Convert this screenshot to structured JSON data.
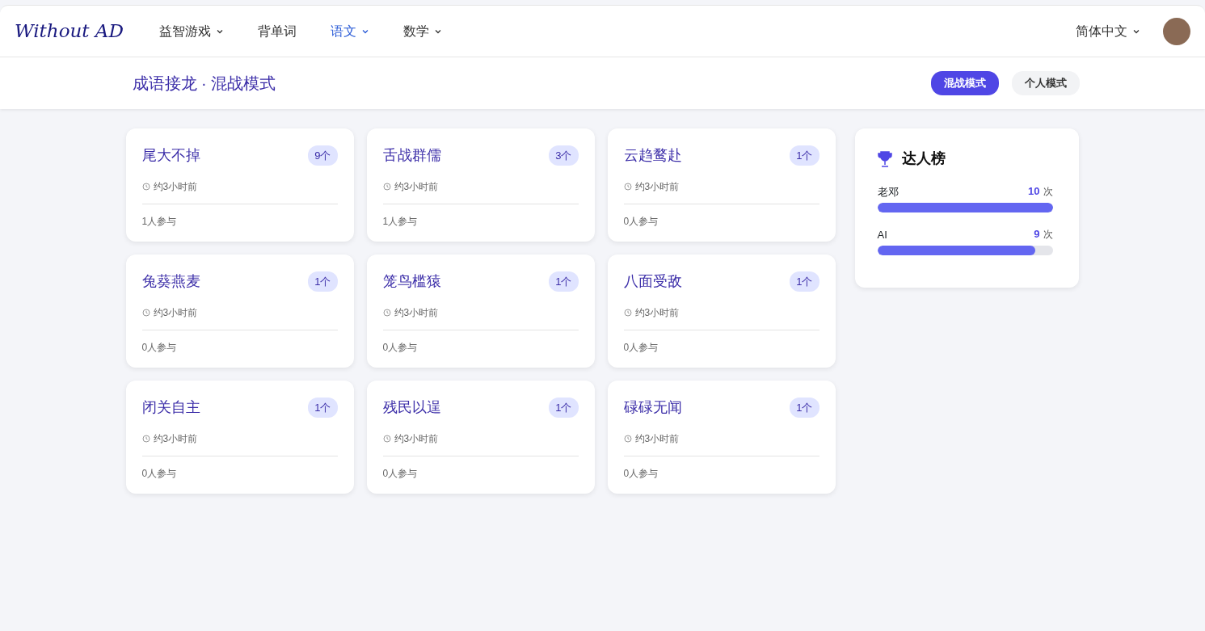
{
  "navbar": {
    "logo": "Without AD",
    "menu": [
      {
        "label": "益智游戏",
        "dropdown": true,
        "selected": false
      },
      {
        "label": "背单词",
        "dropdown": false,
        "selected": false
      },
      {
        "label": "语文",
        "dropdown": true,
        "selected": true
      },
      {
        "label": "数学",
        "dropdown": true,
        "selected": false
      }
    ],
    "language": "简体中文"
  },
  "header": {
    "title": "成语接龙 · 混战模式",
    "modes": [
      {
        "label": "混战模式",
        "selected": true
      },
      {
        "label": "个人模式",
        "selected": false
      }
    ]
  },
  "games": [
    {
      "idiom": "尾大不掉",
      "count": "9个",
      "time": "约3小时前",
      "participants": "1人参与"
    },
    {
      "idiom": "舌战群儒",
      "count": "3个",
      "time": "约3小时前",
      "participants": "1人参与"
    },
    {
      "idiom": "云趋鹜赴",
      "count": "1个",
      "time": "约3小时前",
      "participants": "0人参与"
    },
    {
      "idiom": "兔葵燕麦",
      "count": "1个",
      "time": "约3小时前",
      "participants": "0人参与"
    },
    {
      "idiom": "笼鸟槛猿",
      "count": "1个",
      "time": "约3小时前",
      "participants": "0人参与"
    },
    {
      "idiom": "八面受敌",
      "count": "1个",
      "time": "约3小时前",
      "participants": "0人参与"
    },
    {
      "idiom": "闭关自主",
      "count": "1个",
      "time": "约3小时前",
      "participants": "0人参与"
    },
    {
      "idiom": "残民以逞",
      "count": "1个",
      "time": "约3小时前",
      "participants": "0人参与"
    },
    {
      "idiom": "碌碌无闻",
      "count": "1个",
      "time": "约3小时前",
      "participants": "0人参与"
    }
  ],
  "leaderboard": {
    "title": "达人榜",
    "entries": [
      {
        "name": "老邓",
        "count": "10",
        "unit": "次",
        "level": 1.0
      },
      {
        "name": "AI",
        "count": "9",
        "unit": "次",
        "level": 0.9
      }
    ]
  }
}
